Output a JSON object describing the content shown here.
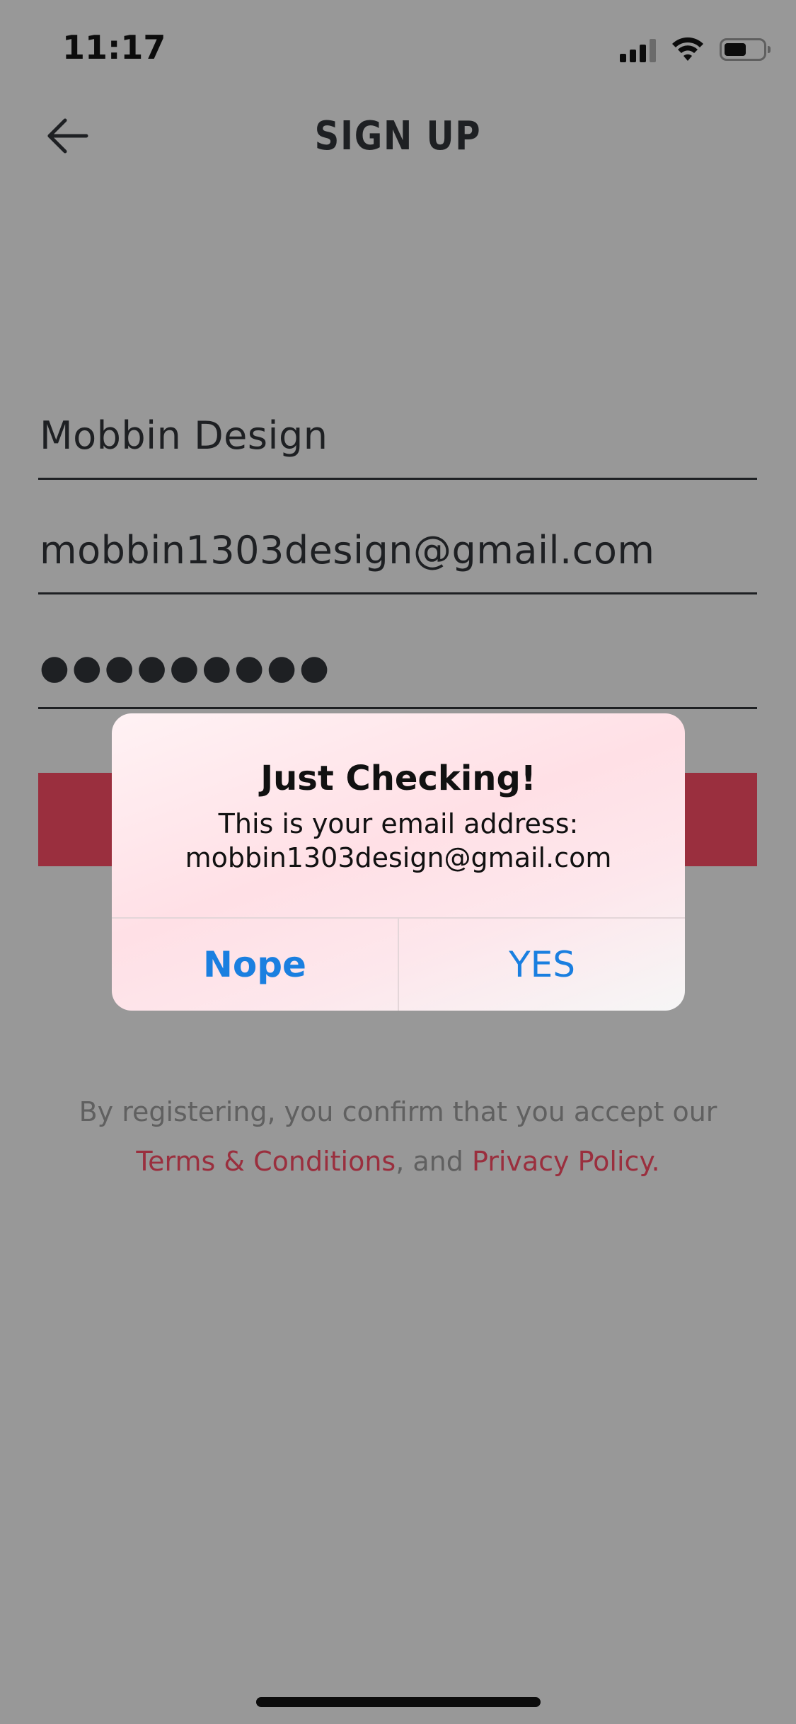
{
  "status_bar": {
    "time": "11:17",
    "icons": [
      "signal-icon",
      "wifi-icon",
      "battery-icon"
    ]
  },
  "header": {
    "title": "SIGN UP",
    "back_icon": "arrow-left-icon"
  },
  "form": {
    "name_value": "Mobbin Design",
    "email_value": "mobbin1303design@gmail.com",
    "password_value": "●●●●●●●●●"
  },
  "terms": {
    "line1": "By registering, you confirm that you accept our",
    "terms_link": "Terms & Conditions",
    "separator": ", and ",
    "privacy_link": "Privacy Policy",
    "period": "."
  },
  "alert": {
    "title": "Just Checking!",
    "message_line1": "This is your email address:",
    "message_line2": "mobbin1303design@gmail.com",
    "cancel_label": "Nope",
    "confirm_label": "YES"
  },
  "colors": {
    "overlay_background": "#989898",
    "accent": "#9a2f3e",
    "alert_button": "#1a7fe0"
  }
}
